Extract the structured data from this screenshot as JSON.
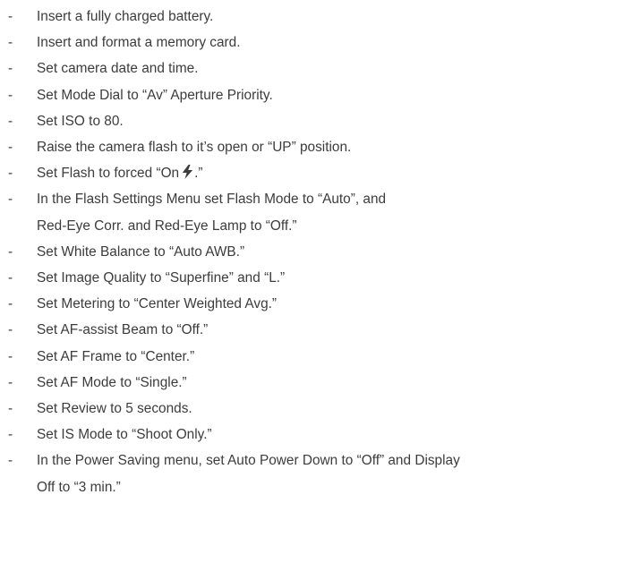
{
  "checklist": {
    "bullet": "-",
    "items": [
      {
        "text": "Insert a fully charged battery."
      },
      {
        "text": "Insert and format a memory card."
      },
      {
        "text": "Set camera date and time."
      },
      {
        "text": "Set Mode Dial to “Av” Aperture Priority."
      },
      {
        "text": "Set ISO to 80."
      },
      {
        "text": "Raise the camera flash to it’s open or “UP” position."
      },
      {
        "text_before": "Set Flash to forced “On",
        "icon": "flash-bolt-icon",
        "text_after": ".”"
      },
      {
        "text": "In the Flash Settings Menu set Flash Mode to “Auto”, and",
        "continuation": "Red-Eye Corr. and Red-Eye Lamp to “Off.”"
      },
      {
        "text": "Set White Balance to “Auto AWB.”"
      },
      {
        "text": "Set Image Quality to “Superfine” and  “L.”"
      },
      {
        "text": "Set Metering to “Center Weighted Avg.”"
      },
      {
        "text": "Set AF-assist Beam to “Off.”"
      },
      {
        "text": "Set AF Frame to “Center.”"
      },
      {
        "text": "Set AF Mode to “Single.”"
      },
      {
        "text": "Set Review to 5 seconds."
      },
      {
        "text": "Set IS Mode to “Shoot Only.”"
      },
      {
        "text": "In the Power Saving menu, set Auto Power Down to “Off” and Display",
        "continuation": "Off to “3 min.”"
      }
    ]
  },
  "colors": {
    "text": "#3c3c3c",
    "background": "#ffffff"
  }
}
